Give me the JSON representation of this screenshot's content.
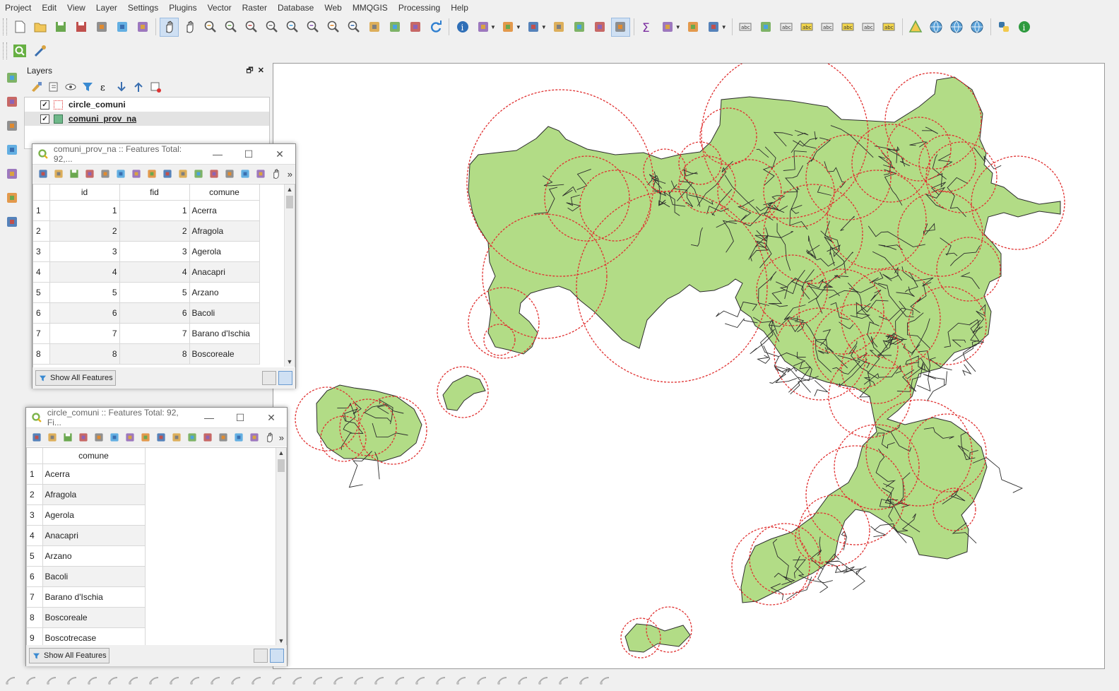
{
  "menu": [
    "Project",
    "Edit",
    "View",
    "Layer",
    "Settings",
    "Plugins",
    "Vector",
    "Raster",
    "Database",
    "Web",
    "MMQGIS",
    "Processing",
    "Help"
  ],
  "icons": {
    "toolbar1": [
      "new-project-icon",
      "open-project-icon",
      "save-project-icon",
      "save-as-icon",
      "new-print-layout-icon",
      "print-layout-manager-icon",
      "style-manager-icon",
      "pan-icon",
      "pan-to-selection-icon",
      "zoom-in-icon",
      "zoom-out-icon",
      "zoom-native-icon",
      "zoom-full-icon",
      "zoom-to-selection-icon",
      "zoom-to-layer-icon",
      "zoom-last-icon",
      "zoom-next-icon",
      "new-map-view-icon",
      "new-3d-view-icon",
      "bookmark-icon",
      "refresh-icon",
      "identify-icon",
      "action-icon",
      "select-features-icon",
      "select-by-value-icon",
      "deselect-icon",
      "attribute-table-icon",
      "field-calculator-icon",
      "processing-toolbox-icon",
      "statistics-icon",
      "measure-icon",
      "map-tips-icon",
      "text-annotation-icon",
      "label-icon",
      "diagram-icon",
      "pin-label-icon",
      "show-hide-label-icon",
      "move-label-icon",
      "rotate-label-icon",
      "change-label-icon",
      "label-options-icon",
      "triangle-tool-icon",
      "globe-icon",
      "globe-search-icon",
      "globe-plugin-icon",
      "python-icon",
      "info-plugin-icon"
    ],
    "toolbar2": [
      "search-locator-icon",
      "plugin-tool-icon"
    ],
    "left": [
      "add-vector-layer-icon",
      "add-raster-layer-icon",
      "digitize-icon",
      "edit-pencil-icon",
      "gps-icon",
      "database-icon",
      "georeferencer-icon"
    ]
  },
  "layers_panel": {
    "title": "Layers",
    "items": [
      {
        "name": "circle_comuni",
        "checked": true,
        "symbol": "outline"
      },
      {
        "name": "comuni_prov_na",
        "checked": true,
        "symbol": "fill"
      }
    ]
  },
  "table1": {
    "title": "comuni_prov_na :: Features Total: 92,...",
    "columns": [
      "id",
      "fid",
      "comune"
    ],
    "rows": [
      [
        "1",
        "1",
        "1",
        "Acerra"
      ],
      [
        "2",
        "2",
        "2",
        "Afragola"
      ],
      [
        "3",
        "3",
        "3",
        "Agerola"
      ],
      [
        "4",
        "4",
        "4",
        "Anacapri"
      ],
      [
        "5",
        "5",
        "5",
        "Arzano"
      ],
      [
        "6",
        "6",
        "6",
        "Bacoli"
      ],
      [
        "7",
        "7",
        "7",
        "Barano d'Ischia"
      ],
      [
        "8",
        "8",
        "8",
        "Boscoreale"
      ]
    ],
    "show_all": "Show All Features"
  },
  "table2": {
    "title": "circle_comuni :: Features Total: 92, Fi...",
    "columns": [
      "comune"
    ],
    "rows": [
      [
        "1",
        "Acerra"
      ],
      [
        "2",
        "Afragola"
      ],
      [
        "3",
        "Agerola"
      ],
      [
        "4",
        "Anacapri"
      ],
      [
        "5",
        "Arzano"
      ],
      [
        "6",
        "Bacoli"
      ],
      [
        "7",
        "Barano d'Ischia"
      ],
      [
        "8",
        "Boscoreale"
      ],
      [
        "9",
        "Boscotrecase"
      ]
    ],
    "show_all": "Show All Features"
  },
  "colors": {
    "land": "#b2dc86",
    "land_stroke": "#2c2c2c",
    "circle": "#e03030",
    "accent": "#cfe0f3"
  }
}
